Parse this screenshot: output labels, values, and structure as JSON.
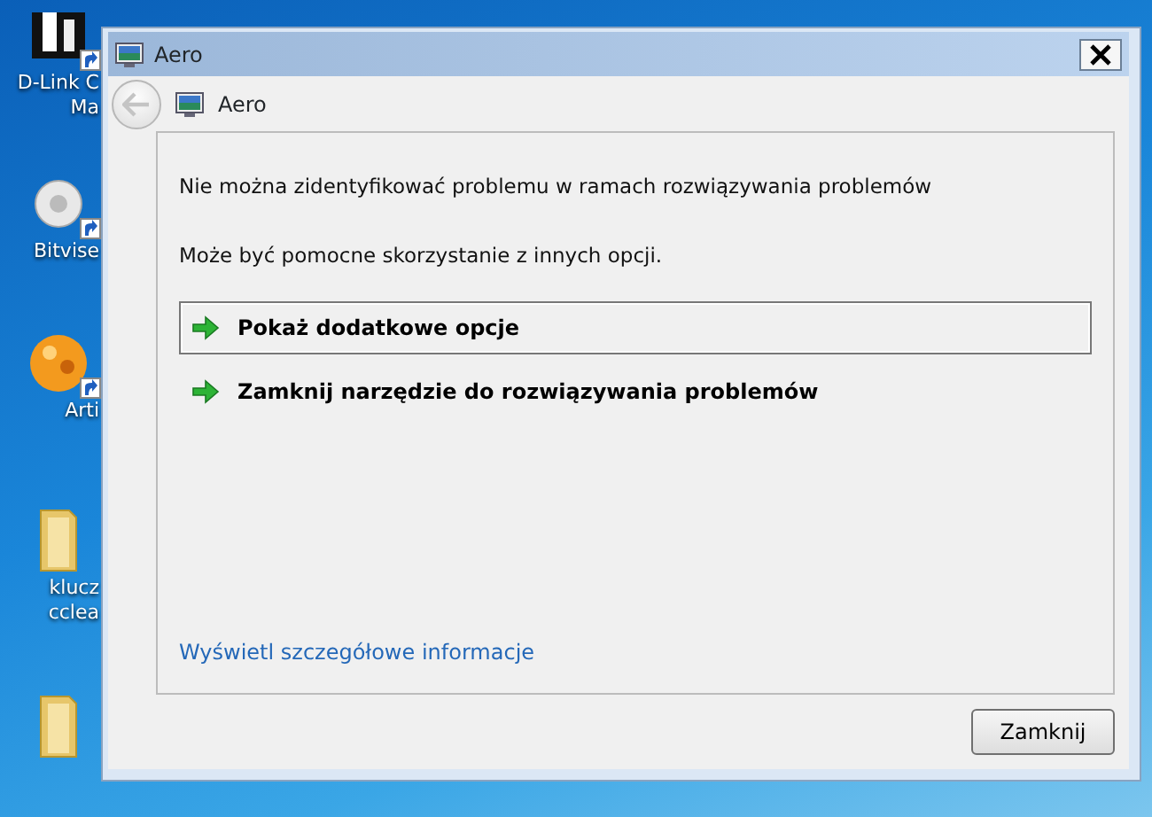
{
  "desktop": {
    "icons": [
      {
        "kind": "app",
        "shortcut": true,
        "label_lines": [
          "D-Link C",
          "Ma"
        ]
      },
      {
        "kind": "gear",
        "shortcut": true,
        "label_lines": [
          "Bitvise"
        ]
      },
      {
        "kind": "orange",
        "shortcut": true,
        "label_lines": [
          "Arti"
        ]
      },
      {
        "kind": "folder",
        "shortcut": false,
        "label_lines": [
          "klucz",
          "cclea"
        ]
      },
      {
        "kind": "folder",
        "shortcut": false
      }
    ]
  },
  "dialog": {
    "title": "Aero",
    "back_disabled": true,
    "heading": "Aero",
    "message": "Nie można zidentyfikować problemu w ramach rozwiązywania problemów",
    "hint": "Może być pomocne skorzystanie z innych opcji.",
    "options": [
      {
        "label": "Pokaż dodatkowe opcje",
        "selected": true
      },
      {
        "label": "Zamknij narzędzie do rozwiązywania problemów",
        "selected": false
      }
    ],
    "details_link": "Wyświetl szczegółowe informacje",
    "buttons": [
      "Zamknij"
    ]
  }
}
